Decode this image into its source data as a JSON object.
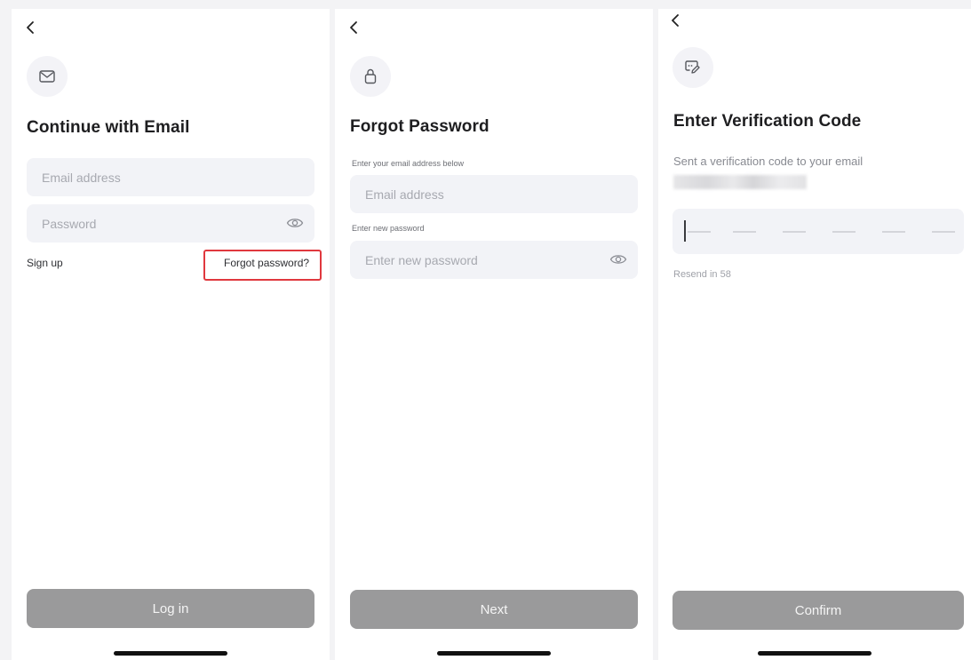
{
  "screen1": {
    "title": "Continue with Email",
    "email_placeholder": "Email address",
    "password_placeholder": "Password",
    "signup_label": "Sign up",
    "forgot_label": "Forgot password?",
    "login_label": "Log in",
    "icon": "mail-icon"
  },
  "screen2": {
    "title": "Forgot Password",
    "email_label": "Enter your email address below",
    "email_placeholder": "Email address",
    "new_password_label": "Enter new password",
    "new_password_placeholder": "Enter new password",
    "next_label": "Next",
    "icon": "lock-icon"
  },
  "screen3": {
    "title": "Enter Verification Code",
    "subtitle": "Sent a verification code to your email",
    "resend_label": "Resend in 58",
    "confirm_label": "Confirm",
    "icon": "message-edit-icon"
  },
  "colors": {
    "highlight": "#e0383e",
    "button_disabled": "#9a9a9b",
    "field_bg": "#f2f3f7"
  }
}
